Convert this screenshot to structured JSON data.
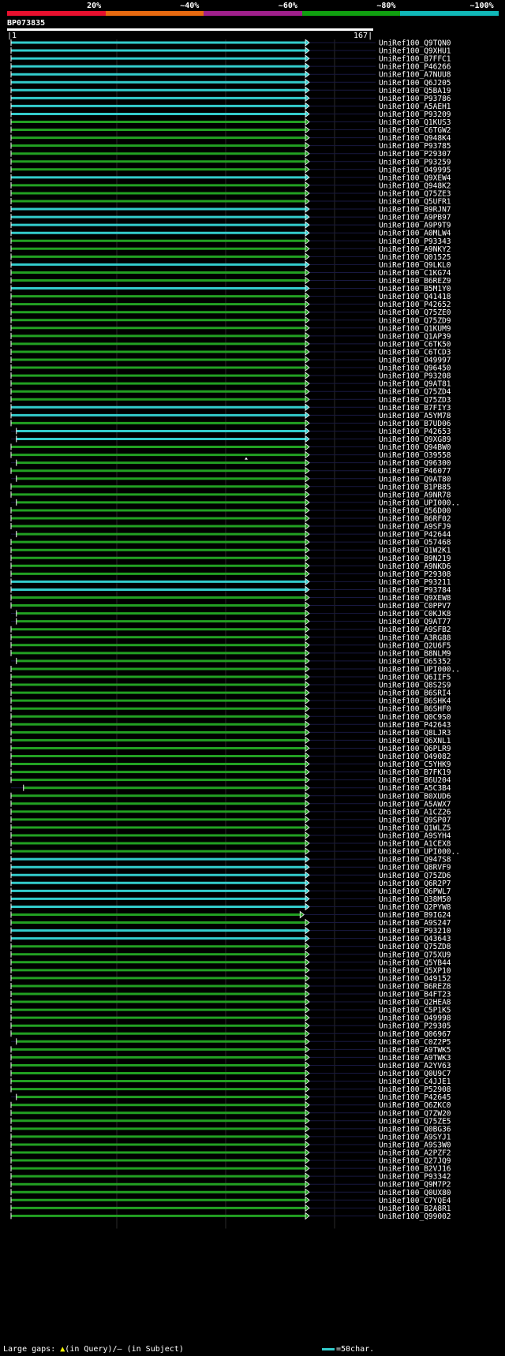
{
  "query": {
    "name": "BP073835",
    "start": "1",
    "end": "167"
  },
  "scale": {
    "labels": [
      "20%",
      "~40%",
      "~60%",
      "~80%",
      "~100%"
    ],
    "colors": [
      "#e8102e",
      "#e86a10",
      "#a0208c",
      "#10a010",
      "#10b8b8"
    ]
  },
  "colors": {
    "cyan": "#33cccc",
    "green": "#22a022",
    "white": "#ffffff"
  },
  "legend": {
    "large_gaps": "Large gaps:",
    "in_query": "(in Query)/",
    "dash": "–",
    "in_subject": "(in Subject)",
    "char_scale": "=50char."
  },
  "hits": [
    {
      "name": "UniRef100_Q9TQN0",
      "color": "cyan",
      "start": 1,
      "end": 167
    },
    {
      "name": "UniRef100_Q9XHU1",
      "color": "cyan",
      "start": 1,
      "end": 167
    },
    {
      "name": "UniRef100_B7FFC1",
      "color": "cyan",
      "start": 1,
      "end": 167
    },
    {
      "name": "UniRef100_P46266",
      "color": "cyan",
      "start": 1,
      "end": 167
    },
    {
      "name": "UniRef100_A7NUU8",
      "color": "cyan",
      "start": 1,
      "end": 167
    },
    {
      "name": "UniRef100_Q6J205",
      "color": "cyan",
      "start": 1,
      "end": 167
    },
    {
      "name": "UniRef100_Q5BA19",
      "color": "cyan",
      "start": 1,
      "end": 167
    },
    {
      "name": "UniRef100_P93786",
      "color": "cyan",
      "start": 1,
      "end": 167
    },
    {
      "name": "UniRef100_A5AEH1",
      "color": "cyan",
      "start": 1,
      "end": 167
    },
    {
      "name": "UniRef100_P93209",
      "color": "cyan",
      "start": 1,
      "end": 167
    },
    {
      "name": "UniRef100_Q1KUS3",
      "color": "green",
      "start": 1,
      "end": 167
    },
    {
      "name": "UniRef100_C6TGW2",
      "color": "green",
      "start": 1,
      "end": 167
    },
    {
      "name": "UniRef100_Q948K4",
      "color": "green",
      "start": 1,
      "end": 167
    },
    {
      "name": "UniRef100_P93785",
      "color": "green",
      "start": 1,
      "end": 167
    },
    {
      "name": "UniRef100_P29307",
      "color": "green",
      "start": 1,
      "end": 167
    },
    {
      "name": "UniRef100_P93259",
      "color": "green",
      "start": 1,
      "end": 167
    },
    {
      "name": "UniRef100_O49995",
      "color": "green",
      "start": 1,
      "end": 167
    },
    {
      "name": "UniRef100_Q9XEW4",
      "color": "cyan",
      "start": 1,
      "end": 167
    },
    {
      "name": "UniRef100_Q948K2",
      "color": "green",
      "start": 1,
      "end": 167
    },
    {
      "name": "UniRef100_Q75ZE3",
      "color": "green",
      "start": 1,
      "end": 167
    },
    {
      "name": "UniRef100_Q5UFR1",
      "color": "green",
      "start": 1,
      "end": 167
    },
    {
      "name": "UniRef100_B9RJN7",
      "color": "cyan",
      "start": 1,
      "end": 167
    },
    {
      "name": "UniRef100_A9PB97",
      "color": "cyan",
      "start": 1,
      "end": 167
    },
    {
      "name": "UniRef100_A9P9T9",
      "color": "cyan",
      "start": 1,
      "end": 167
    },
    {
      "name": "UniRef100_A0MLW4",
      "color": "cyan",
      "start": 1,
      "end": 167
    },
    {
      "name": "UniRef100_P93343",
      "color": "green",
      "start": 1,
      "end": 167
    },
    {
      "name": "UniRef100_A9NKY2",
      "color": "green",
      "start": 1,
      "end": 167
    },
    {
      "name": "UniRef100_Q01525",
      "color": "green",
      "start": 1,
      "end": 167
    },
    {
      "name": "UniRef100_Q9LKL0",
      "color": "cyan",
      "start": 1,
      "end": 167
    },
    {
      "name": "UniRef100_C1KG74",
      "color": "green",
      "start": 1,
      "end": 167
    },
    {
      "name": "UniRef100_B6REZ9",
      "color": "green",
      "start": 1,
      "end": 167
    },
    {
      "name": "UniRef100_B5M1Y0",
      "color": "cyan",
      "start": 1,
      "end": 167
    },
    {
      "name": "UniRef100_Q41418",
      "color": "green",
      "start": 1,
      "end": 167
    },
    {
      "name": "UniRef100_P42652",
      "color": "green",
      "start": 1,
      "end": 167
    },
    {
      "name": "UniRef100_Q75ZE0",
      "color": "green",
      "start": 1,
      "end": 167
    },
    {
      "name": "UniRef100_Q75ZD9",
      "color": "green",
      "start": 1,
      "end": 167
    },
    {
      "name": "UniRef100_Q1KUM9",
      "color": "green",
      "start": 1,
      "end": 167
    },
    {
      "name": "UniRef100_Q1AP39",
      "color": "green",
      "start": 1,
      "end": 167
    },
    {
      "name": "UniRef100_C6TK50",
      "color": "green",
      "start": 1,
      "end": 167
    },
    {
      "name": "UniRef100_C6TCD3",
      "color": "green",
      "start": 1,
      "end": 167
    },
    {
      "name": "UniRef100_O49997",
      "color": "green",
      "start": 1,
      "end": 167
    },
    {
      "name": "UniRef100_Q96450",
      "color": "green",
      "start": 1,
      "end": 167
    },
    {
      "name": "UniRef100_P93208",
      "color": "green",
      "start": 1,
      "end": 167
    },
    {
      "name": "UniRef100_Q9AT81",
      "color": "green",
      "start": 1,
      "end": 167
    },
    {
      "name": "UniRef100_Q75ZD4",
      "color": "green",
      "start": 1,
      "end": 167
    },
    {
      "name": "UniRef100_Q75ZD3",
      "color": "green",
      "start": 1,
      "end": 167
    },
    {
      "name": "UniRef100_B7FIY3",
      "color": "cyan",
      "start": 1,
      "end": 167
    },
    {
      "name": "UniRef100_A5YM78",
      "color": "cyan",
      "start": 1,
      "end": 167
    },
    {
      "name": "UniRef100_B7UD06",
      "color": "green",
      "start": 1,
      "end": 167
    },
    {
      "name": "UniRef100_P42653",
      "color": "cyan",
      "start": 4,
      "end": 167
    },
    {
      "name": "UniRef100_Q9XG89",
      "color": "cyan",
      "start": 4,
      "end": 167
    },
    {
      "name": "UniRef100_Q94BW0",
      "color": "green",
      "start": 1,
      "end": 167
    },
    {
      "name": "UniRef100_O39558",
      "color": "green",
      "start": 1,
      "end": 167
    },
    {
      "name": "UniRef100_Q96300",
      "color": "green",
      "start": 4,
      "end": 167
    },
    {
      "name": "UniRef100_P46077",
      "color": "green",
      "start": 1,
      "end": 167
    },
    {
      "name": "UniRef100_Q9AT80",
      "color": "green",
      "start": 4,
      "end": 167
    },
    {
      "name": "UniRef100_B1PB85",
      "color": "green",
      "start": 1,
      "end": 167
    },
    {
      "name": "UniRef100_A9NR78",
      "color": "green",
      "start": 1,
      "end": 167
    },
    {
      "name": "UniRef100_UPI000..",
      "color": "green",
      "start": 4,
      "end": 167
    },
    {
      "name": "UniRef100_Q56D00",
      "color": "green",
      "start": 1,
      "end": 167
    },
    {
      "name": "UniRef100_B6RF02",
      "color": "green",
      "start": 1,
      "end": 167
    },
    {
      "name": "UniRef100_A9SFJ9",
      "color": "green",
      "start": 1,
      "end": 167
    },
    {
      "name": "UniRef100_P42644",
      "color": "green",
      "start": 4,
      "end": 167
    },
    {
      "name": "UniRef100_O57468",
      "color": "green",
      "start": 1,
      "end": 167
    },
    {
      "name": "UniRef100_Q1W2K1",
      "color": "green",
      "start": 1,
      "end": 167
    },
    {
      "name": "UniRef100_B9N219",
      "color": "green",
      "start": 1,
      "end": 167
    },
    {
      "name": "UniRef100_A9NKD6",
      "color": "green",
      "start": 1,
      "end": 167
    },
    {
      "name": "UniRef100_P29308",
      "color": "green",
      "start": 1,
      "end": 167
    },
    {
      "name": "UniRef100_P93211",
      "color": "cyan",
      "start": 1,
      "end": 167
    },
    {
      "name": "UniRef100_P93784",
      "color": "cyan",
      "start": 1,
      "end": 167
    },
    {
      "name": "UniRef100_Q9XEW8",
      "color": "green",
      "start": 1,
      "end": 167
    },
    {
      "name": "UniRef100_C0PPV7",
      "color": "green",
      "start": 1,
      "end": 167
    },
    {
      "name": "UniRef100_C0KJK8",
      "color": "green",
      "start": 4,
      "end": 167
    },
    {
      "name": "UniRef100_Q9AT77",
      "color": "green",
      "start": 4,
      "end": 167
    },
    {
      "name": "UniRef100_A9SFB2",
      "color": "green",
      "start": 1,
      "end": 167
    },
    {
      "name": "UniRef100_A3RG88",
      "color": "green",
      "start": 1,
      "end": 167
    },
    {
      "name": "UniRef100_Q2U6F5",
      "color": "green",
      "start": 1,
      "end": 167
    },
    {
      "name": "UniRef100_B8NLM9",
      "color": "green",
      "start": 1,
      "end": 167
    },
    {
      "name": "UniRef100_O65352",
      "color": "green",
      "start": 4,
      "end": 167
    },
    {
      "name": "UniRef100_UPI000..",
      "color": "green",
      "start": 1,
      "end": 167
    },
    {
      "name": "UniRef100_Q6IIF5",
      "color": "green",
      "start": 1,
      "end": 167
    },
    {
      "name": "UniRef100_Q8S2S9",
      "color": "green",
      "start": 1,
      "end": 167
    },
    {
      "name": "UniRef100_B6SRI4",
      "color": "green",
      "start": 1,
      "end": 167
    },
    {
      "name": "UniRef100_B6SHK4",
      "color": "green",
      "start": 1,
      "end": 167
    },
    {
      "name": "UniRef100_B6SHF0",
      "color": "green",
      "start": 1,
      "end": 167
    },
    {
      "name": "UniRef100_Q0C9S0",
      "color": "green",
      "start": 1,
      "end": 167
    },
    {
      "name": "UniRef100_P42643",
      "color": "green",
      "start": 1,
      "end": 167
    },
    {
      "name": "UniRef100_Q8LJR3",
      "color": "green",
      "start": 1,
      "end": 167
    },
    {
      "name": "UniRef100_Q6XNL1",
      "color": "green",
      "start": 1,
      "end": 167
    },
    {
      "name": "UniRef100_Q6PLR9",
      "color": "green",
      "start": 1,
      "end": 167
    },
    {
      "name": "UniRef100_O49082",
      "color": "green",
      "start": 1,
      "end": 167
    },
    {
      "name": "UniRef100_C5YHK9",
      "color": "green",
      "start": 1,
      "end": 167
    },
    {
      "name": "UniRef100_B7FK19",
      "color": "green",
      "start": 1,
      "end": 167
    },
    {
      "name": "UniRef100_B6U204",
      "color": "green",
      "start": 1,
      "end": 167
    },
    {
      "name": "UniRef100_A5C3B4",
      "color": "green",
      "start": 8,
      "end": 167
    },
    {
      "name": "UniRef100_B0XUD6",
      "color": "green",
      "start": 1,
      "end": 167
    },
    {
      "name": "UniRef100_A5AWX7",
      "color": "green",
      "start": 1,
      "end": 167
    },
    {
      "name": "UniRef100_A1CZ26",
      "color": "green",
      "start": 1,
      "end": 167
    },
    {
      "name": "UniRef100_Q9SP07",
      "color": "green",
      "start": 1,
      "end": 167
    },
    {
      "name": "UniRef100_Q1WLZ5",
      "color": "green",
      "start": 1,
      "end": 167
    },
    {
      "name": "UniRef100_A9SYH4",
      "color": "green",
      "start": 1,
      "end": 167
    },
    {
      "name": "UniRef100_A1CEX8",
      "color": "green",
      "start": 1,
      "end": 167
    },
    {
      "name": "UniRef100_UPI000..",
      "color": "green",
      "start": 1,
      "end": 167
    },
    {
      "name": "UniRef100_Q947S8",
      "color": "cyan",
      "start": 1,
      "end": 167
    },
    {
      "name": "UniRef100_Q8RVF9",
      "color": "cyan",
      "start": 1,
      "end": 167
    },
    {
      "name": "UniRef100_Q75ZD6",
      "color": "cyan",
      "start": 1,
      "end": 167
    },
    {
      "name": "UniRef100_Q6R2P7",
      "color": "cyan",
      "start": 1,
      "end": 167
    },
    {
      "name": "UniRef100_Q6PWL7",
      "color": "cyan",
      "start": 1,
      "end": 167
    },
    {
      "name": "UniRef100_Q38M50",
      "color": "cyan",
      "start": 1,
      "end": 167
    },
    {
      "name": "UniRef100_Q2PYW8",
      "color": "cyan",
      "start": 1,
      "end": 167
    },
    {
      "name": "UniRef100_B9IG24",
      "color": "green",
      "start": 1,
      "end": 164
    },
    {
      "name": "UniRef100_A9S247",
      "color": "green",
      "start": 1,
      "end": 167
    },
    {
      "name": "UniRef100_P93210",
      "color": "cyan",
      "start": 1,
      "end": 167
    },
    {
      "name": "UniRef100_Q43643",
      "color": "cyan",
      "start": 1,
      "end": 167
    },
    {
      "name": "UniRef100_Q75ZD8",
      "color": "green",
      "start": 1,
      "end": 167
    },
    {
      "name": "UniRef100_Q75XU9",
      "color": "green",
      "start": 1,
      "end": 167
    },
    {
      "name": "UniRef100_Q5YB44",
      "color": "green",
      "start": 1,
      "end": 167
    },
    {
      "name": "UniRef100_Q5XP10",
      "color": "green",
      "start": 1,
      "end": 167
    },
    {
      "name": "UniRef100_O49152",
      "color": "green",
      "start": 1,
      "end": 167
    },
    {
      "name": "UniRef100_B6REZ8",
      "color": "green",
      "start": 1,
      "end": 167
    },
    {
      "name": "UniRef100_B4FT23",
      "color": "green",
      "start": 1,
      "end": 167
    },
    {
      "name": "UniRef100_Q2HEA8",
      "color": "green",
      "start": 1,
      "end": 167
    },
    {
      "name": "UniRef100_C5P1K5",
      "color": "green",
      "start": 1,
      "end": 167
    },
    {
      "name": "UniRef100_O49998",
      "color": "green",
      "start": 1,
      "end": 167
    },
    {
      "name": "UniRef100_P29305",
      "color": "green",
      "start": 1,
      "end": 167
    },
    {
      "name": "UniRef100_Q06967",
      "color": "green",
      "start": 1,
      "end": 167
    },
    {
      "name": "UniRef100_C0Z2P5",
      "color": "green",
      "start": 4,
      "end": 167
    },
    {
      "name": "UniRef100_A9TWK5",
      "color": "green",
      "start": 1,
      "end": 167
    },
    {
      "name": "UniRef100_A9TWK3",
      "color": "green",
      "start": 1,
      "end": 167
    },
    {
      "name": "UniRef100_A2YV63",
      "color": "green",
      "start": 1,
      "end": 167
    },
    {
      "name": "UniRef100_Q0U9C7",
      "color": "green",
      "start": 1,
      "end": 167
    },
    {
      "name": "UniRef100_C4JJE1",
      "color": "green",
      "start": 1,
      "end": 167
    },
    {
      "name": "UniRef100_P52908",
      "color": "green",
      "start": 1,
      "end": 167
    },
    {
      "name": "UniRef100_P42645",
      "color": "green",
      "start": 4,
      "end": 167
    },
    {
      "name": "UniRef100_Q6ZKC0",
      "color": "green",
      "start": 1,
      "end": 167
    },
    {
      "name": "UniRef100_Q7ZW20",
      "color": "green",
      "start": 1,
      "end": 167
    },
    {
      "name": "UniRef100_Q75ZE5",
      "color": "green",
      "start": 1,
      "end": 167
    },
    {
      "name": "UniRef100_Q0BG36",
      "color": "green",
      "start": 1,
      "end": 167
    },
    {
      "name": "UniRef100_A9SYJ1",
      "color": "green",
      "start": 1,
      "end": 167
    },
    {
      "name": "UniRef100_A9S3W0",
      "color": "green",
      "start": 1,
      "end": 167
    },
    {
      "name": "UniRef100_A2PZF2",
      "color": "green",
      "start": 1,
      "end": 167
    },
    {
      "name": "UniRef100_Q27JQ9",
      "color": "green",
      "start": 1,
      "end": 167
    },
    {
      "name": "UniRef100_B2VJ16",
      "color": "green",
      "start": 1,
      "end": 167
    },
    {
      "name": "UniRef100_P93342",
      "color": "green",
      "start": 1,
      "end": 167
    },
    {
      "name": "UniRef100_Q9M7P2",
      "color": "green",
      "start": 1,
      "end": 167
    },
    {
      "name": "UniRef100_Q0UX80",
      "color": "green",
      "start": 1,
      "end": 167
    },
    {
      "name": "UniRef100_C7YQE4",
      "color": "green",
      "start": 1,
      "end": 167
    },
    {
      "name": "UniRef100_B2A8R1",
      "color": "green",
      "start": 1,
      "end": 167
    },
    {
      "name": "UniRef100_Q99002",
      "color": "green",
      "start": 1,
      "end": 167
    }
  ]
}
